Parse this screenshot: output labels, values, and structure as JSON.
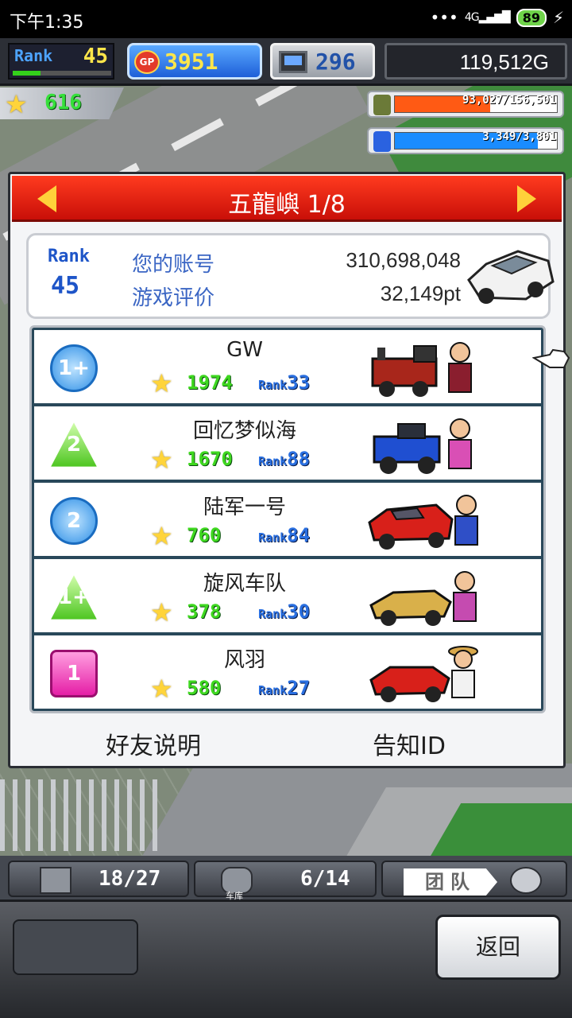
{
  "status_bar": {
    "time": "下午1:35",
    "network": "4G",
    "battery": "89"
  },
  "hud": {
    "rank_label": "Rank",
    "rank_value": "45",
    "rank_progress": 0.28,
    "gp_label": "GP",
    "gp_value": "3951",
    "research_value": "296",
    "money": "119,512G"
  },
  "stars": {
    "value": "616"
  },
  "resources": [
    {
      "icon": "fuel-barrel-icon",
      "value": "93,027/156,501",
      "fraction": 0.59,
      "color": "#ff5a14"
    },
    {
      "icon": "water-bottle-icon",
      "value": "3,349/3,801",
      "fraction": 0.88,
      "color": "#1a8cff"
    }
  ],
  "dialog": {
    "title": "五龍嶼 1/8",
    "account": {
      "rank_label": "Rank",
      "rank_value": "45",
      "id_label": "您的账号",
      "id_value": "310,698,048",
      "score_label": "游戏评价",
      "score_value": "32,149pt"
    },
    "friends": [
      {
        "badge": "1+",
        "badge_shape": "circle",
        "name": "GW",
        "stars": "1974",
        "rank_label": "Rank",
        "rank": "33"
      },
      {
        "badge": "2",
        "badge_shape": "tri",
        "name": "回忆梦似海",
        "stars": "1670",
        "rank_label": "Rank",
        "rank": "88"
      },
      {
        "badge": "2",
        "badge_shape": "circle",
        "name": "陆军一号",
        "stars": "760",
        "rank_label": "Rank",
        "rank": "84"
      },
      {
        "badge": "1+",
        "badge_shape": "tri",
        "name": "旋风车队",
        "stars": "378",
        "rank_label": "Rank",
        "rank": "30"
      },
      {
        "badge": "1",
        "badge_shape": "square",
        "name": "风羽",
        "stars": "580",
        "rank_label": "Rank",
        "rank": "27"
      }
    ],
    "footer": {
      "left": "好友说明",
      "right": "告知ID"
    }
  },
  "bottom": {
    "tab1_value": "18/27",
    "tab2_label": "车库",
    "tab2_value": "6/14",
    "tab3_label": "团队",
    "back": "返回"
  },
  "colors": {
    "header_red": "#e8180f",
    "accent_blue": "#1e55c8",
    "star_green": "#3fd820"
  }
}
